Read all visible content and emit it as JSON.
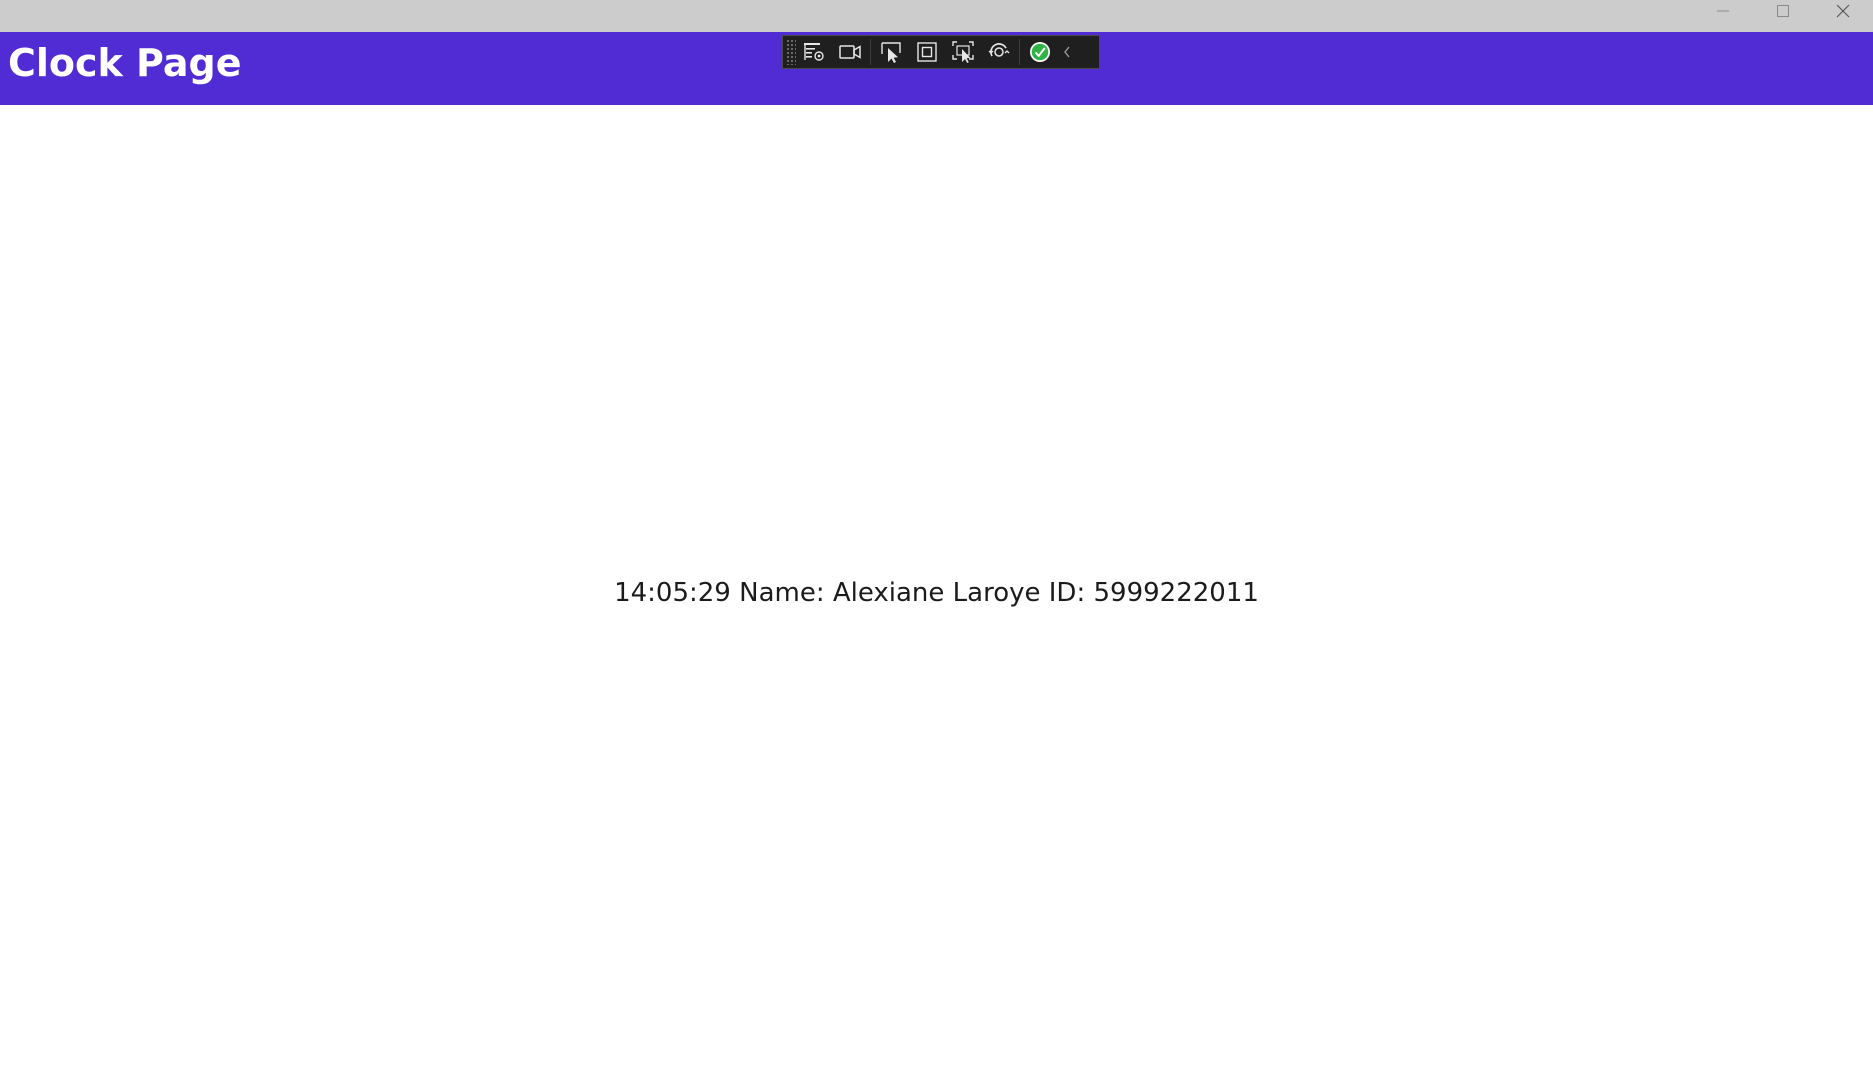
{
  "window": {
    "controls": {
      "minimize_icon": "minimize-icon",
      "maximize_icon": "maximize-icon",
      "close_icon": "close-icon"
    }
  },
  "header": {
    "title": "Clock Page",
    "background_color": "#512bd4",
    "text_color": "#ffffff"
  },
  "dev_toolbar": {
    "buttons": [
      {
        "icon": "live-visual-tree-icon"
      },
      {
        "icon": "video-camera-icon"
      },
      {
        "icon": "select-element-icon"
      },
      {
        "icon": "display-layout-adorners-icon"
      },
      {
        "icon": "track-focused-element-icon"
      },
      {
        "icon": "hot-reload-icon"
      },
      {
        "icon": "binding-failures-check-icon"
      }
    ],
    "collapse_icon": "chevron-left-icon",
    "status_color": "#2fb344"
  },
  "main": {
    "clock_text": "14:05:29 Name: Alexiane Laroye ID: 5999222011"
  }
}
